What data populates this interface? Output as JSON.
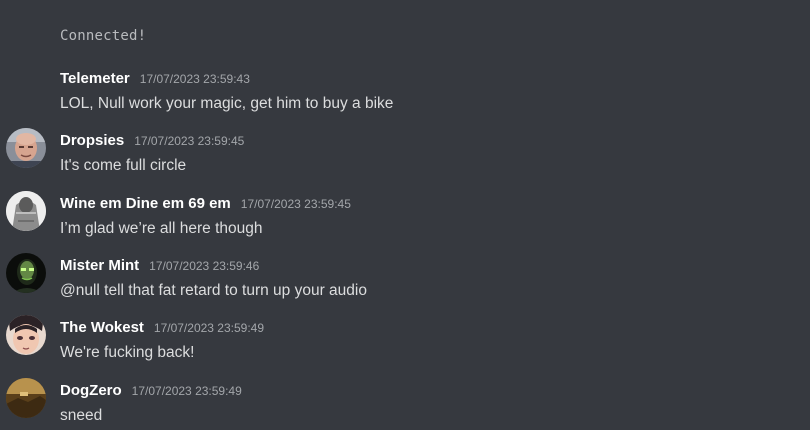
{
  "status": "Connected!",
  "messages": [
    {
      "author": "Telemeter",
      "timestamp": "17/07/2023 23:59:43",
      "text": "LOL, Null work your magic, get him to buy a bike",
      "avatar": null
    },
    {
      "author": "Dropsies",
      "timestamp": "17/07/2023 23:59:45",
      "text": "It's come full circle",
      "avatar": "bald-man-photo"
    },
    {
      "author": "Wine em Dine em 69 em",
      "timestamp": "17/07/2023 23:59:45",
      "text": "I’m glad we’re all here though",
      "avatar": "gray-figure-photo"
    },
    {
      "author": "Mister Mint",
      "timestamp": "17/07/2023 23:59:46",
      "text": "@null tell that fat retard to turn up your audio",
      "avatar": "green-glow-face"
    },
    {
      "author": "The Wokest",
      "timestamp": "17/07/2023 23:59:49",
      "text": "We're fucking back!",
      "avatar": "anime-face"
    },
    {
      "author": "DogZero",
      "timestamp": "17/07/2023 23:59:49",
      "text": "sneed",
      "avatar": "sepia-landscape"
    }
  ],
  "colors": {
    "background": "#36393f",
    "author": "#ffffff",
    "text": "#dcddde",
    "timestamp": "#a3a6aa"
  }
}
